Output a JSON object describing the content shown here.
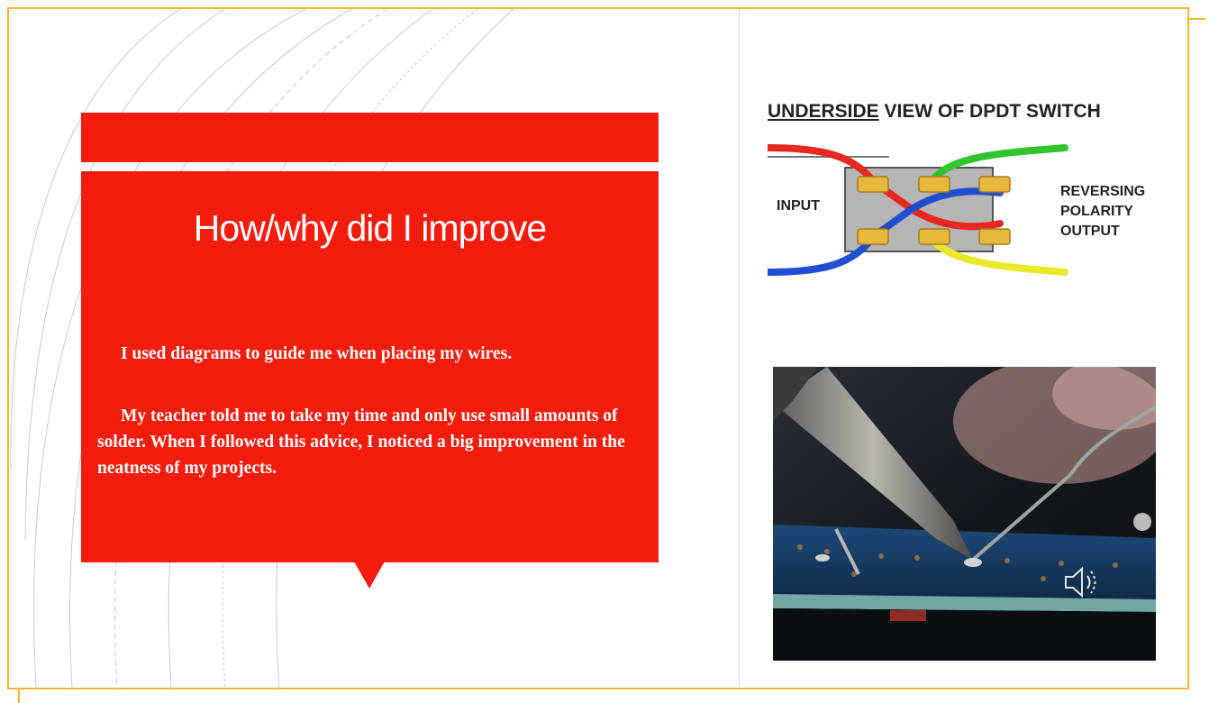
{
  "slide": {
    "title": "How/why did I improve",
    "paragraphs": [
      "I used diagrams to guide me when placing my wires.",
      "My teacher told me to take my time and only use small amounts of solder. When I followed this advice, I noticed a big improvement in the neatness of my projects."
    ]
  },
  "diagram": {
    "title_underlined": "UNDERSIDE",
    "title_rest": " VIEW OF DPDT SWITCH",
    "input_label": "INPUT",
    "output_label_lines": [
      "REVERSING",
      "POLARITY",
      "OUTPUT"
    ],
    "wire_colors": [
      "#e8281e",
      "#1f4fd0",
      "#33c32d",
      "#e9e92a"
    ]
  },
  "photo": {
    "icon": "speaker-icon"
  },
  "colors": {
    "accent_red": "#f61c0d",
    "frame_gold": "#f2b632"
  }
}
